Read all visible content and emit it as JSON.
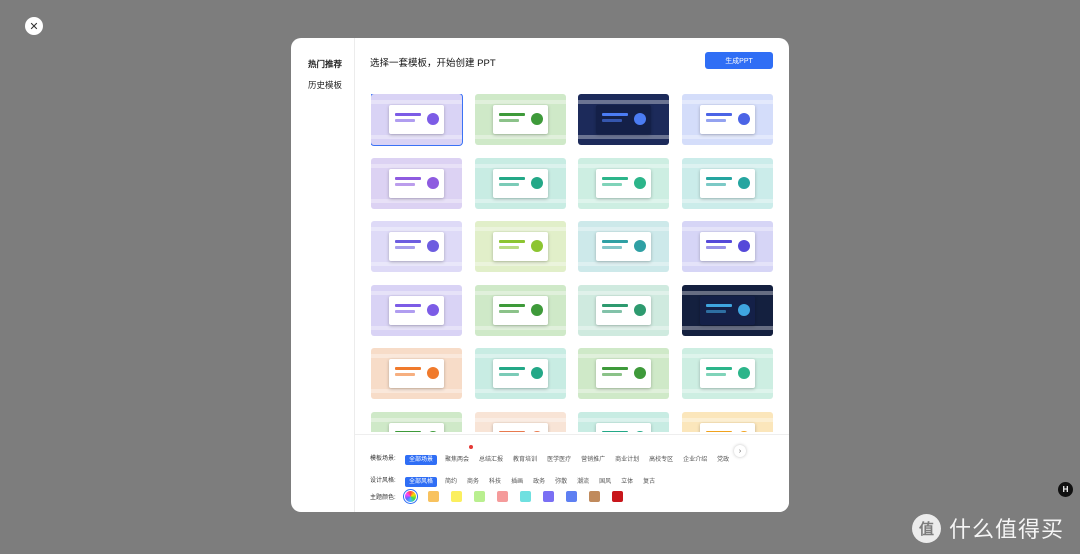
{
  "sidebar": {
    "items": [
      "热门推荐",
      "历史模板"
    ]
  },
  "header": {
    "title": "选择一套模板，开始创建 PPT",
    "generate_label": "生成PPT"
  },
  "templates": [
    {
      "theme": "purple"
    },
    {
      "theme": "green"
    },
    {
      "theme": "navy"
    },
    {
      "theme": "blue"
    },
    {
      "theme": "violet"
    },
    {
      "theme": "teal"
    },
    {
      "theme": "mint"
    },
    {
      "theme": "cyan"
    },
    {
      "theme": "lavender"
    },
    {
      "theme": "lime"
    },
    {
      "theme": "aqua"
    },
    {
      "theme": "indigo"
    },
    {
      "theme": "purple"
    },
    {
      "theme": "green"
    },
    {
      "theme": "jade"
    },
    {
      "theme": "dark"
    },
    {
      "theme": "orange"
    },
    {
      "theme": "teal"
    },
    {
      "theme": "green"
    },
    {
      "theme": "mint"
    },
    {
      "theme": "green"
    },
    {
      "theme": "peach"
    },
    {
      "theme": "teal"
    },
    {
      "theme": "amber"
    }
  ],
  "theme_colors": {
    "purple": [
      "#d9d3f5",
      "#7c5ce6"
    ],
    "green": [
      "#cfe9c8",
      "#3e9a3a"
    ],
    "navy": [
      "#1c2a5a",
      "#4b7cf3"
    ],
    "blue": [
      "#d4ddfa",
      "#4b64e6"
    ],
    "violet": [
      "#dcd2f3",
      "#8e5be0"
    ],
    "teal": [
      "#c8ece3",
      "#23a887"
    ],
    "mint": [
      "#cdeee2",
      "#2cb58a"
    ],
    "cyan": [
      "#cbecea",
      "#25a5a0"
    ],
    "lavender": [
      "#dedaf7",
      "#6d5de0"
    ],
    "lime": [
      "#e1efc9",
      "#8cc531"
    ],
    "aqua": [
      "#cde9ea",
      "#2fa0a4"
    ],
    "indigo": [
      "#d6d5f6",
      "#5549d9"
    ],
    "jade": [
      "#cfeadf",
      "#2e9a6f"
    ],
    "dark": [
      "#14203f",
      "#3fa5e0"
    ],
    "orange": [
      "#f7dcc8",
      "#f07a2c"
    ],
    "peach": [
      "#f8e4d6",
      "#e87a4e"
    ],
    "amber": [
      "#fbe6bb",
      "#f0a21d"
    ]
  },
  "filters": {
    "scene": {
      "label": "模板场景:",
      "options": [
        "全部场景",
        "聚焦两会",
        "总结汇报",
        "教育培训",
        "医学医疗",
        "营销推广",
        "商业计划",
        "高校专区",
        "企业介绍",
        "党政"
      ],
      "selected": "全部场景"
    },
    "style": {
      "label": "设计风格:",
      "options": [
        "全部风格",
        "简约",
        "商务",
        "科技",
        "插画",
        "政务",
        "弥散",
        "潮流",
        "国风",
        "立体",
        "复古"
      ],
      "selected": "全部风格"
    },
    "color": {
      "label": "主题颜色:",
      "swatches": [
        "rainbow",
        "#f8c25e",
        "#fbef5e",
        "#b9ef8f",
        "#f59b9b",
        "#6fe0e0",
        "#7a6ff4",
        "#5e7ff2",
        "#c08a5c",
        "#c8161b"
      ]
    }
  },
  "watermark": {
    "logo_char": "值",
    "text": "什么值得买"
  },
  "corner_badge": "H"
}
